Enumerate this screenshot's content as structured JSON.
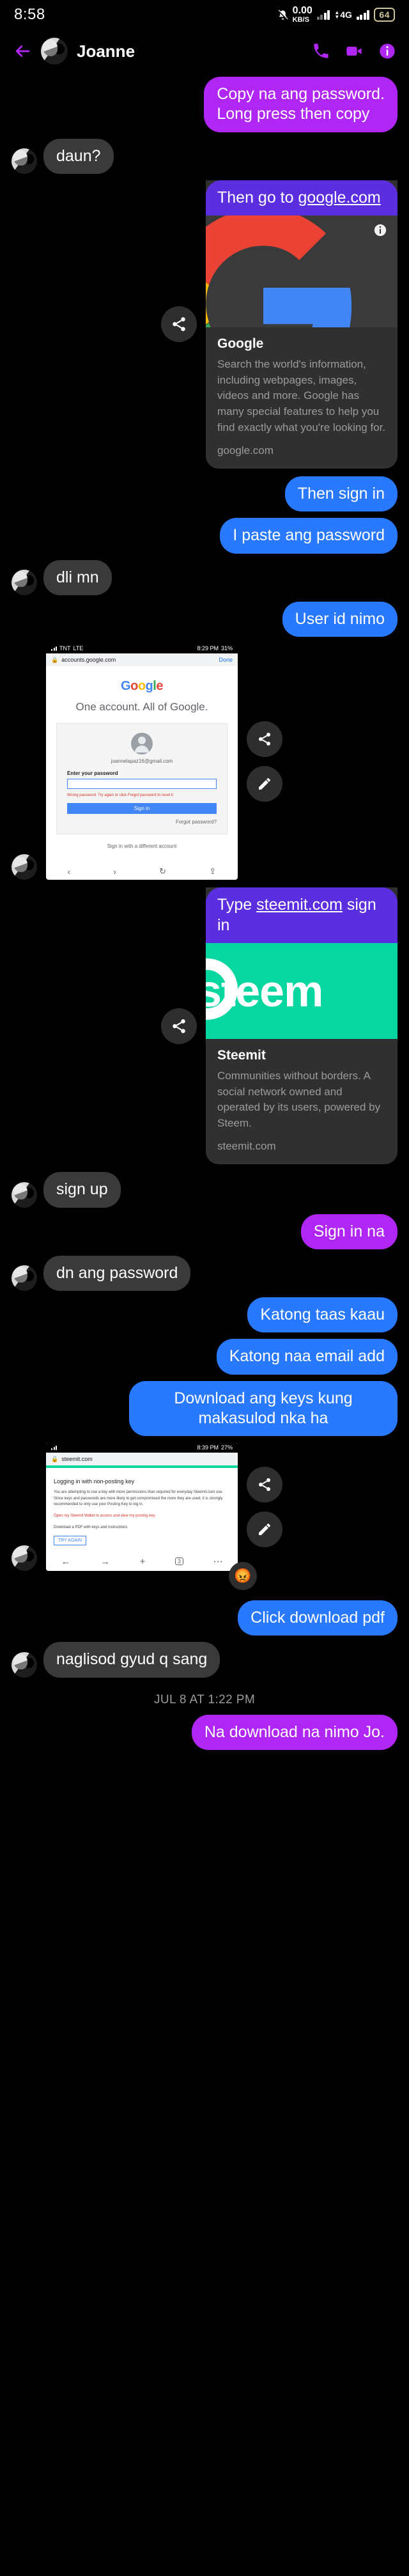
{
  "statusbar": {
    "time": "8:58",
    "bell_icon": "bell-muted-icon",
    "net_speed": "0.00",
    "net_unit": "KB/S",
    "network_type": "4G",
    "battery": "64"
  },
  "header": {
    "back_icon": "back-arrow-icon",
    "avatar": "contact-avatar",
    "title": "Joanne",
    "call_icon": "phone-icon",
    "video_icon": "video-camera-icon",
    "info_icon": "info-icon"
  },
  "messages": [
    {
      "id": "m1",
      "side": "out",
      "style": "purple",
      "text": "Copy na ang password.\nLong press then copy"
    },
    {
      "id": "m2",
      "side": "in",
      "style": "grey",
      "text": "daun?"
    },
    {
      "id": "m3",
      "side": "out",
      "style": "card-google",
      "text": "Then go to google.com",
      "link": "google.com"
    },
    {
      "id": "m4",
      "side": "out",
      "style": "blue",
      "text": "Then sign in"
    },
    {
      "id": "m5",
      "side": "out",
      "style": "blue",
      "text": "I paste ang password"
    },
    {
      "id": "m6",
      "side": "in",
      "style": "grey",
      "text": "dli mn"
    },
    {
      "id": "m7",
      "side": "out",
      "style": "blue",
      "text": "User id nimo"
    },
    {
      "id": "m8",
      "side": "out",
      "style": "shot-google"
    },
    {
      "id": "m9",
      "side": "out",
      "style": "card-steemit",
      "text": "Type steemit.com sign in",
      "link": "steemit.com"
    },
    {
      "id": "m10",
      "side": "in",
      "style": "grey",
      "text": "sign up"
    },
    {
      "id": "m11",
      "side": "out",
      "style": "purple",
      "text": "Sign in na"
    },
    {
      "id": "m12",
      "side": "in",
      "style": "grey",
      "text": "dn ang password"
    },
    {
      "id": "m13",
      "side": "out",
      "style": "blue",
      "text": "Katong taas kaau"
    },
    {
      "id": "m14",
      "side": "out",
      "style": "blue",
      "text": "Katong naa email add"
    },
    {
      "id": "m15",
      "side": "out",
      "style": "blue",
      "text": "Download ang keys kung makasulod nka ha"
    },
    {
      "id": "m16",
      "side": "out",
      "style": "shot-steemit"
    },
    {
      "id": "m17",
      "side": "out",
      "style": "blue",
      "text": "Click download pdf"
    },
    {
      "id": "m18",
      "side": "in",
      "style": "grey",
      "text": "naglisod gyud q sang"
    },
    {
      "id": "m19",
      "side": "out",
      "style": "purple",
      "text": "Na download na nimo Jo."
    }
  ],
  "google_card": {
    "header_prefix": "Then go to ",
    "header_link": "google.com",
    "title": "Google",
    "description": "Search the world's information, including webpages, images, videos and more. Google has many special features to help you find exactly what you're looking for.",
    "domain": "google.com",
    "share_icon": "share-icon",
    "info_icon": "info-icon",
    "logo": "google-g-logo"
  },
  "steemit_card": {
    "header_prefix": "Type ",
    "header_link": "steemit.com",
    "header_suffix": " sign in",
    "banner_word": "steem",
    "title": "Steemit",
    "description": "Communities without borders. A social network owned and operated by its users, powered by Steem.",
    "domain": "steemit.com",
    "share_icon": "share-icon"
  },
  "google_shot": {
    "carrier": "TNT",
    "network": "LTE",
    "battery": "31%",
    "clock": "8:29 PM",
    "url": "accounts.google.com",
    "done_label": "Done",
    "lock_icon": "lock-icon",
    "wordmark": [
      "G",
      "o",
      "o",
      "g",
      "l",
      "e"
    ],
    "headline": "One account. All of Google.",
    "account_email": "joannelapaz16@gmail.com",
    "password_label": "Enter your password",
    "password_value": "",
    "error_text": "Wrong password. Try again or click Forgot password to reset it.",
    "signin_label": "Sign in",
    "forgot_label": "Forgot password?",
    "different_account": "Sign in with a different account",
    "nav": [
      "back-icon",
      "forward-icon",
      "reload-icon",
      "share-icon"
    ],
    "share_icon": "share-icon",
    "edit_icon": "pencil-icon"
  },
  "steemit_shot": {
    "clock": "8:39 PM",
    "battery": "27%",
    "url": "steemit.com",
    "heading": "Logging in with non-posting key",
    "paragraph": "You are attempting to use a key with more permissions than required for everyday Steemit.com use. Since keys and passwords are more likely to get compromised the more they are used, it is strongly recommended to only use your Posting Key to log in.",
    "warning": "Open my Steemit Wallet to access and view my posting key.",
    "download_note": "Download a PDF with keys and instructions",
    "button_label": "TRY AGAIN",
    "nav_tabs": "3",
    "reaction": "😡",
    "share_icon": "share-icon",
    "edit_icon": "pencil-icon"
  },
  "daystamp": "JUL 8 AT 1:22 PM",
  "colors": {
    "purple": "#b026f5",
    "indigo": "#5b2fe0",
    "blue": "#2979ff",
    "grey": "#3a3a3a",
    "accent": "#b026f5",
    "steemit_green": "#06d6a0"
  }
}
